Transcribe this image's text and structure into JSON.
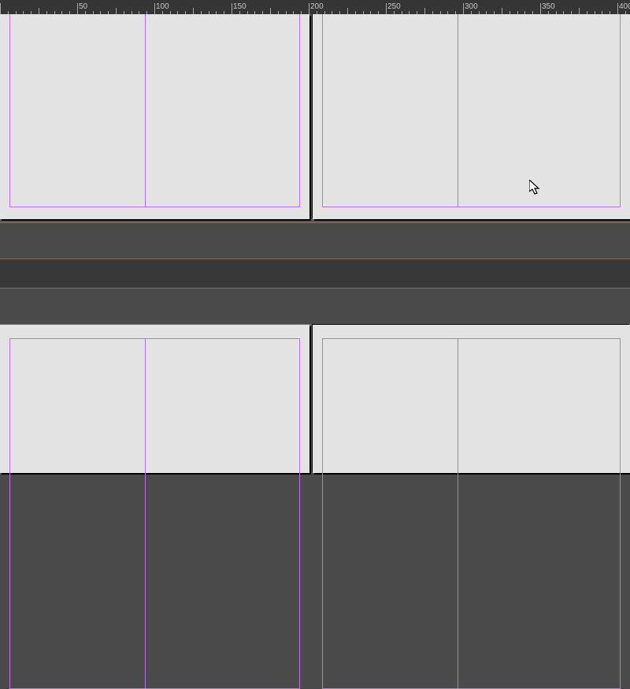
{
  "ruler": {
    "major_interval": 50,
    "labels": [
      50,
      100,
      150,
      200,
      250,
      300,
      350,
      400
    ]
  },
  "colors": {
    "guide": "#c46fe8",
    "paper": "#e3e3e3",
    "pasteboard": "#595959",
    "gap": "#4a4a4a",
    "ruler_bg": "#353535"
  },
  "documents": [
    {
      "id": "doc-top",
      "pages": [
        "left",
        "right"
      ]
    },
    {
      "id": "doc-bottom",
      "pages": [
        "left",
        "right"
      ]
    }
  ],
  "cursor": {
    "type": "arrow"
  }
}
